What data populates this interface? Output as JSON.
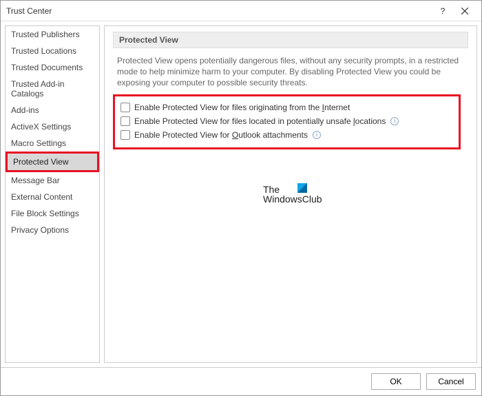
{
  "window": {
    "title": "Trust Center"
  },
  "sidebar": {
    "items": [
      {
        "label": "Trusted Publishers"
      },
      {
        "label": "Trusted Locations"
      },
      {
        "label": "Trusted Documents"
      },
      {
        "label": "Trusted Add-in Catalogs"
      },
      {
        "label": "Add-ins"
      },
      {
        "label": "ActiveX Settings"
      },
      {
        "label": "Macro Settings"
      },
      {
        "label": "Protected View",
        "selected": true
      },
      {
        "label": "Message Bar"
      },
      {
        "label": "External Content"
      },
      {
        "label": "File Block Settings"
      },
      {
        "label": "Privacy Options"
      }
    ]
  },
  "main": {
    "section_title": "Protected View",
    "description": "Protected View opens potentially dangerous files, without any security prompts, in a restricted mode to help minimize harm to your computer. By disabling Protected View you could be exposing your computer to possible security threats.",
    "checkboxes": [
      {
        "label_pre": "Enable Protected View for files originating from the ",
        "accel": "I",
        "label_post": "nternet",
        "info": false
      },
      {
        "label_pre": "Enable Protected View for files located in potentially unsafe ",
        "accel": "l",
        "label_post": "ocations",
        "info": true
      },
      {
        "label_pre": "Enable Protected View for ",
        "accel": "O",
        "label_post": "utlook attachments",
        "info": true
      }
    ]
  },
  "watermark": {
    "line1": "The",
    "line2": "WindowsClub"
  },
  "footer": {
    "ok": "OK",
    "cancel": "Cancel"
  }
}
